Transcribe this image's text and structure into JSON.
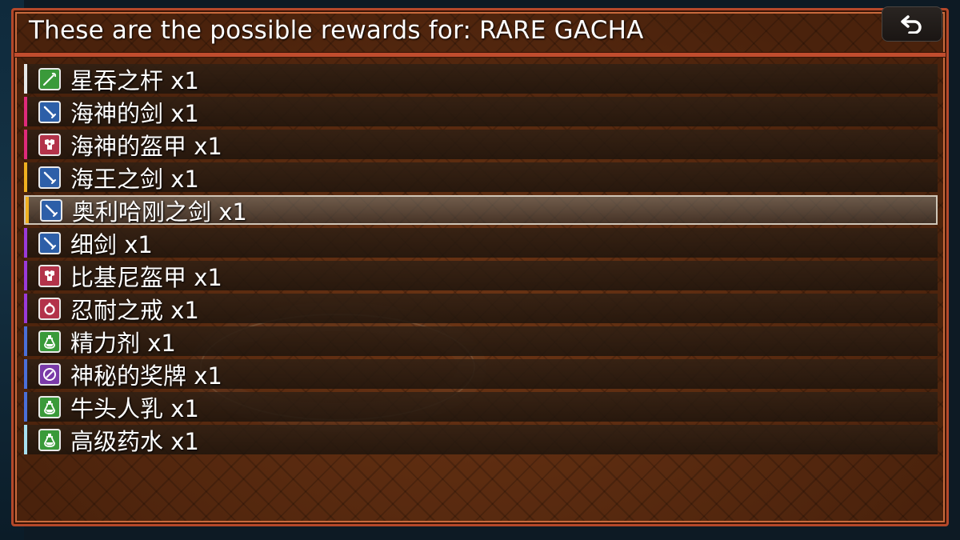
{
  "dialog": {
    "title": "These are the possible rewards for: RARE GACHA"
  },
  "colors": {
    "frame_border": "#b5482a",
    "panel_bg": "#5a2a10",
    "text": "#ffffff"
  },
  "back_button": {
    "icon": "back-arrow-icon"
  },
  "rewards": [
    {
      "name": "星吞之杆 x1",
      "rarity_color": "#e8e8e8",
      "icon": "staff-icon",
      "icon_bg": "#3a9a3a"
    },
    {
      "name": "海神的剑 x1",
      "rarity_color": "#e02a7a",
      "icon": "sword-icon",
      "icon_bg": "#2d5fa8"
    },
    {
      "name": "海神的盔甲 x1",
      "rarity_color": "#e02a7a",
      "icon": "armor-icon",
      "icon_bg": "#b3334a"
    },
    {
      "name": "海王之剑 x1",
      "rarity_color": "#f0b020",
      "icon": "sword-icon",
      "icon_bg": "#2d5fa8"
    },
    {
      "name": "奥利哈刚之剑 x1",
      "rarity_color": "#f0b020",
      "icon": "sword-icon",
      "icon_bg": "#2d5fa8",
      "selected": true
    },
    {
      "name": "细剑 x1",
      "rarity_color": "#9a3ad8",
      "icon": "sword-icon",
      "icon_bg": "#2d5fa8"
    },
    {
      "name": "比基尼盔甲 x1",
      "rarity_color": "#9a3ad8",
      "icon": "armor-icon",
      "icon_bg": "#b3334a"
    },
    {
      "name": "忍耐之戒 x1",
      "rarity_color": "#9a3ad8",
      "icon": "ring-icon",
      "icon_bg": "#b3334a"
    },
    {
      "name": "精力剂 x1",
      "rarity_color": "#4a6fd8",
      "icon": "potion-icon",
      "icon_bg": "#3a9a3a"
    },
    {
      "name": "神秘的奖牌 x1",
      "rarity_color": "#4a6fd8",
      "icon": "medal-icon",
      "icon_bg": "#7a3aa8"
    },
    {
      "name": "牛头人乳 x1",
      "rarity_color": "#4a6fd8",
      "icon": "potion-icon",
      "icon_bg": "#3a9a3a"
    },
    {
      "name": "高级药水 x1",
      "rarity_color": "#a8e0f0",
      "icon": "potion-icon",
      "icon_bg": "#3a9a3a"
    }
  ]
}
